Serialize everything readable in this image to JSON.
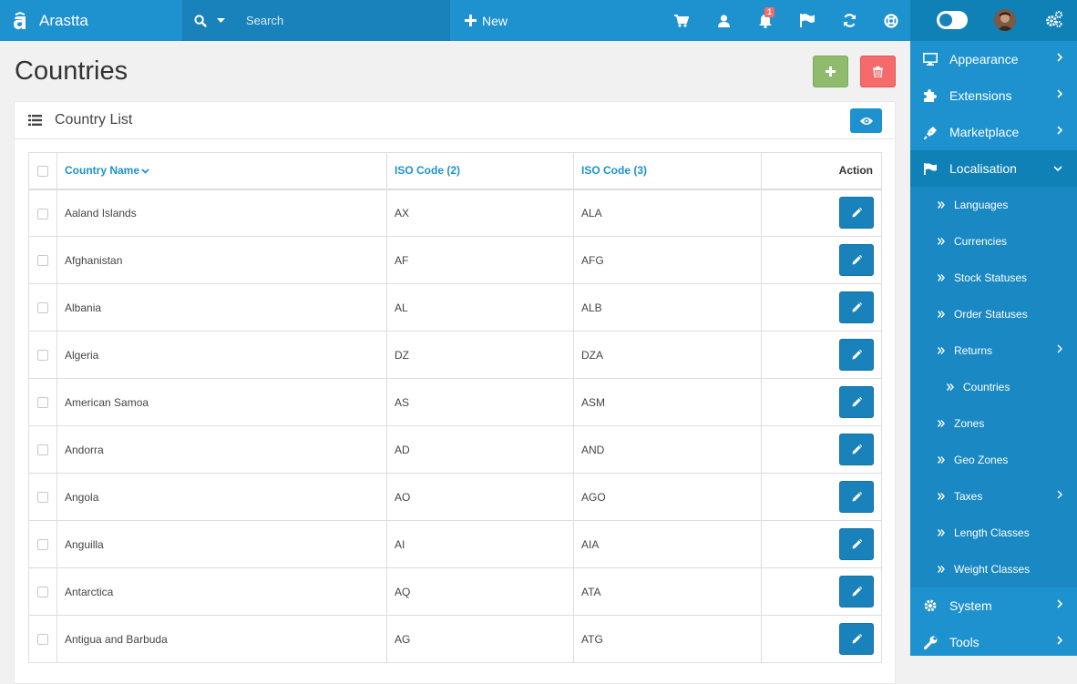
{
  "brand": {
    "name": "Arastta"
  },
  "search": {
    "placeholder": "Search"
  },
  "header": {
    "new_label": "New",
    "notification_count": "1"
  },
  "page": {
    "title": "Countries"
  },
  "panel": {
    "title": "Country List"
  },
  "table": {
    "headers": {
      "name": "Country Name",
      "iso2": "ISO Code (2)",
      "iso3": "ISO Code (3)",
      "action": "Action"
    },
    "rows": [
      {
        "name": "Aaland Islands",
        "iso2": "AX",
        "iso3": "ALA"
      },
      {
        "name": "Afghanistan",
        "iso2": "AF",
        "iso3": "AFG"
      },
      {
        "name": "Albania",
        "iso2": "AL",
        "iso3": "ALB"
      },
      {
        "name": "Algeria",
        "iso2": "DZ",
        "iso3": "DZA"
      },
      {
        "name": "American Samoa",
        "iso2": "AS",
        "iso3": "ASM"
      },
      {
        "name": "Andorra",
        "iso2": "AD",
        "iso3": "AND"
      },
      {
        "name": "Angola",
        "iso2": "AO",
        "iso3": "AGO"
      },
      {
        "name": "Anguilla",
        "iso2": "AI",
        "iso3": "AIA"
      },
      {
        "name": "Antarctica",
        "iso2": "AQ",
        "iso3": "ATA"
      },
      {
        "name": "Antigua and Barbuda",
        "iso2": "AG",
        "iso3": "ATG"
      }
    ]
  },
  "sidebar": {
    "items": [
      {
        "label": "Appearance",
        "icon": "monitor-icon"
      },
      {
        "label": "Extensions",
        "icon": "puzzle-icon"
      },
      {
        "label": "Marketplace",
        "icon": "plug-icon"
      },
      {
        "label": "Localisation",
        "icon": "flag-icon"
      },
      {
        "label": "System",
        "icon": "gear-icon"
      },
      {
        "label": "Tools",
        "icon": "wrench-icon"
      }
    ],
    "localisation_sub": [
      {
        "label": "Languages"
      },
      {
        "label": "Currencies"
      },
      {
        "label": "Stock Statuses"
      },
      {
        "label": "Order Statuses"
      },
      {
        "label": "Returns"
      },
      {
        "label": "Countries"
      },
      {
        "label": "Zones"
      },
      {
        "label": "Geo Zones"
      },
      {
        "label": "Taxes"
      },
      {
        "label": "Length Classes"
      },
      {
        "label": "Weight Classes"
      }
    ]
  },
  "colors": {
    "primary": "#1e91cf",
    "primary_dark": "#0f81b7",
    "success": "#8fbb6c",
    "danger": "#f56b6b"
  }
}
